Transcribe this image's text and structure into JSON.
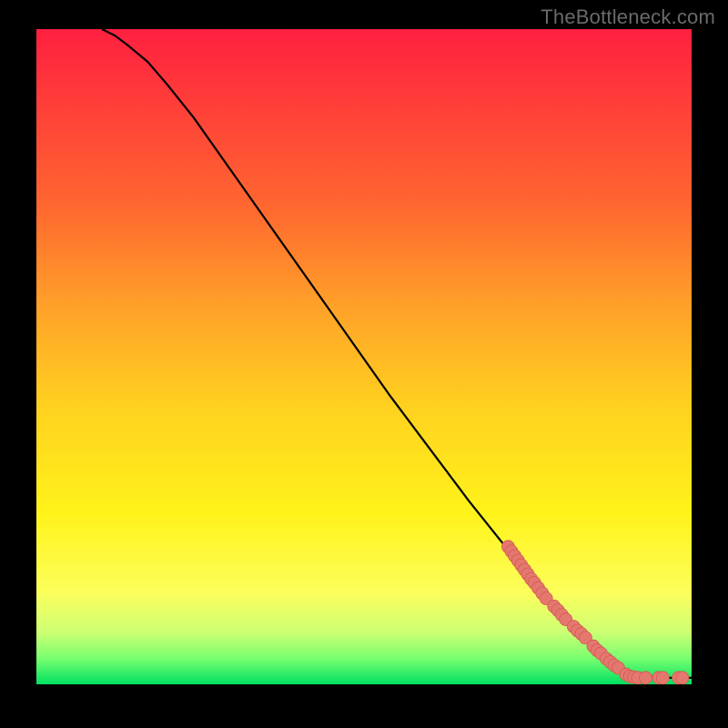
{
  "watermark": "TheBottleneck.com",
  "colors": {
    "dot_fill": "#e4786f",
    "dot_stroke": "#d25a52",
    "curve": "#000000",
    "background": "#000000"
  },
  "chart_data": {
    "type": "line",
    "title": "",
    "xlabel": "",
    "ylabel": "",
    "xlim": [
      0,
      100
    ],
    "ylim": [
      0,
      100
    ],
    "grid": false,
    "legend": false,
    "curve_xy": [
      [
        10,
        100
      ],
      [
        12,
        99
      ],
      [
        14,
        97.5
      ],
      [
        17,
        95
      ],
      [
        20,
        91.5
      ],
      [
        24,
        86.5
      ],
      [
        30,
        78
      ],
      [
        36,
        69.5
      ],
      [
        42,
        61
      ],
      [
        48,
        52.5
      ],
      [
        54,
        44
      ],
      [
        60,
        36
      ],
      [
        66,
        28
      ],
      [
        72,
        20.5
      ],
      [
        76,
        15.5
      ],
      [
        79,
        12
      ],
      [
        82,
        9
      ],
      [
        84,
        7
      ],
      [
        86,
        5
      ],
      [
        88,
        3.5
      ],
      [
        90,
        2.3
      ],
      [
        92,
        1.6
      ],
      [
        94,
        1.2
      ],
      [
        96,
        1
      ],
      [
        100,
        1
      ]
    ],
    "series": [
      {
        "name": "markers",
        "points": [
          [
            72,
            21
          ],
          [
            72.5,
            20.3
          ],
          [
            73,
            19.6
          ],
          [
            73.5,
            18.9
          ],
          [
            74,
            18.2
          ],
          [
            74.5,
            17.5
          ],
          [
            75,
            16.8
          ],
          [
            75.5,
            16.1
          ],
          [
            76,
            15.5
          ],
          [
            76.6,
            14.7
          ],
          [
            77.2,
            13.9
          ],
          [
            77.8,
            13.1
          ],
          [
            79,
            11.9
          ],
          [
            79.6,
            11.3
          ],
          [
            80.2,
            10.6
          ],
          [
            80.8,
            9.9
          ],
          [
            82,
            8.8
          ],
          [
            82.6,
            8.2
          ],
          [
            83.2,
            7.7
          ],
          [
            83.8,
            7.1
          ],
          [
            85,
            5.8
          ],
          [
            85.6,
            5.2
          ],
          [
            86.2,
            4.7
          ],
          [
            87,
            3.9
          ],
          [
            87.6,
            3.4
          ],
          [
            88.2,
            2.9
          ],
          [
            88.8,
            2.5
          ],
          [
            90,
            1.5
          ],
          [
            90.6,
            1.2
          ],
          [
            91.2,
            1.1
          ],
          [
            91.8,
            1
          ],
          [
            93,
            1
          ],
          [
            95,
            1
          ],
          [
            95.6,
            1
          ],
          [
            98,
            1
          ],
          [
            98.6,
            1
          ]
        ]
      }
    ]
  }
}
